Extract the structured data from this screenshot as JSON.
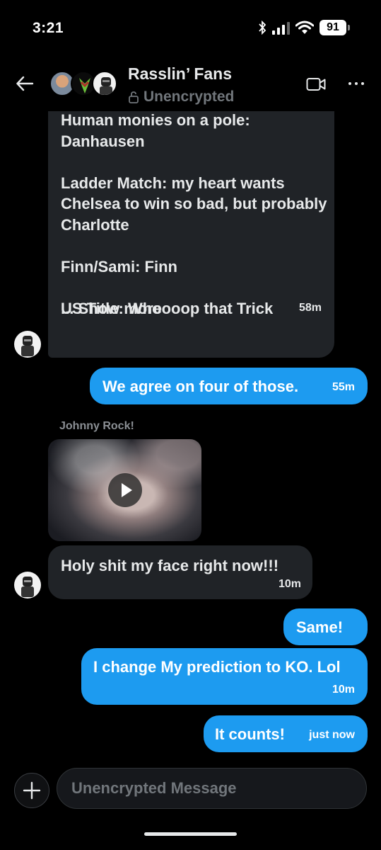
{
  "status_bar": {
    "time": "3:21",
    "battery": "91"
  },
  "header": {
    "title": "Rasslin’ Fans",
    "subtitle": "Unencrypted"
  },
  "messages": [
    {
      "text": "Human monies on a pole:\nDanhausen\n\nLadder Match:  my heart wants Chelsea to win so bad, but probably Charlotte\n\nFinn/Sami: Finn\n\nUS Title: Whoooop that Trick",
      "show_more": "... Show more",
      "time": "58m"
    },
    {
      "text": "We agree on four of those.",
      "time": "55m"
    },
    {
      "sender": "Johnny Rock!"
    },
    {
      "text": "Holy shit my face right now!!!",
      "time": "10m"
    },
    {
      "text": "Same!"
    },
    {
      "text": "I change My prediction to KO. Lol",
      "time": "10m"
    },
    {
      "text": "It counts!",
      "time": "just now"
    }
  ],
  "composer": {
    "placeholder": "Unencrypted Message"
  },
  "icons": [
    "back-arrow-icon",
    "lock-icon",
    "video-call-icon",
    "more-icon",
    "play-icon",
    "plus-icon",
    "bluetooth-icon",
    "signal-icon",
    "wifi-icon",
    "battery-icon"
  ],
  "colors": {
    "background": "#000000",
    "outgoing_bubble": "#1d9bf0",
    "incoming_bubble": "#202327"
  }
}
